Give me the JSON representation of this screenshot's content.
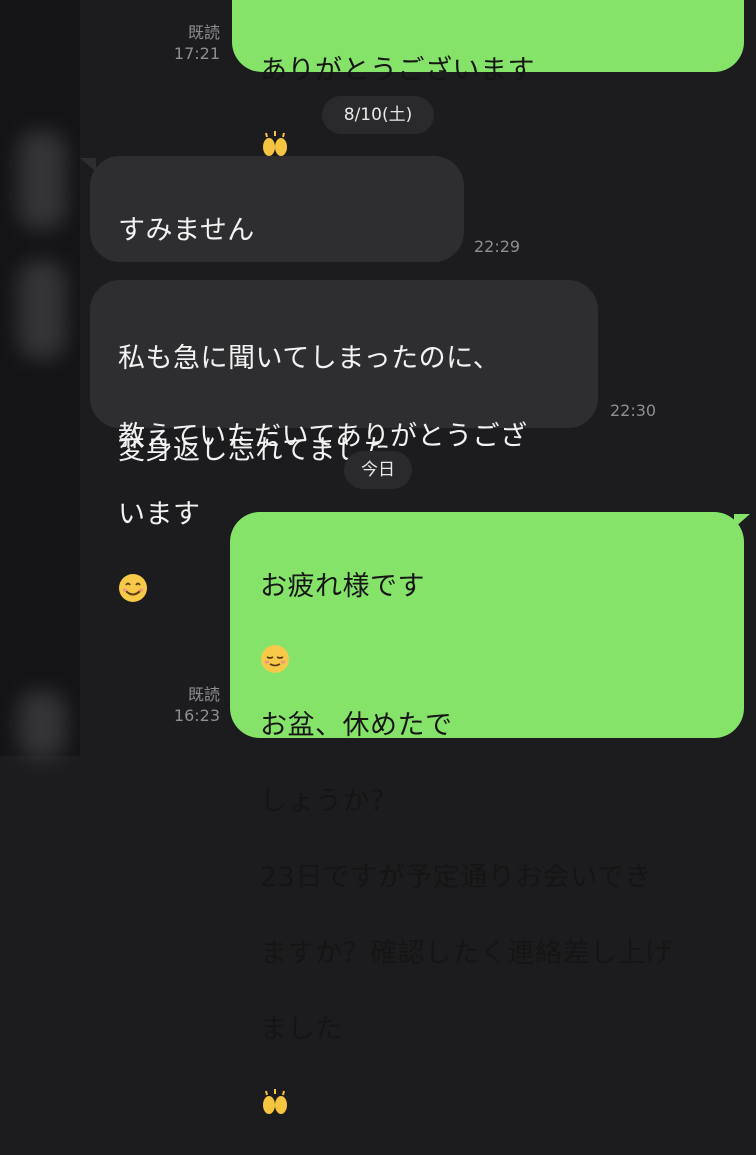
{
  "colors": {
    "background": "#1c1c1e",
    "outgoing_bubble": "#86e36a",
    "incoming_bubble": "#2e2e31",
    "meta_text": "#8e8e93"
  },
  "messages": [
    {
      "direction": "out",
      "text": "ありがとうございます",
      "emoji": "raising-hands-icon",
      "read_label": "既読",
      "time": "17:21"
    },
    {
      "direction": "in",
      "line1": "すみません",
      "line1_emoji": "person-bowing-icon",
      "line2": "変身返し忘れてました、",
      "time": "22:29"
    },
    {
      "direction": "in",
      "line1": "私も急に聞いてしまったのに、",
      "line2": "教えていただいてありがとうござ",
      "line3": "います",
      "line3_emoji": "smiling-face-icon",
      "time": "22:30"
    },
    {
      "direction": "out",
      "line1a": "お疲れ様です",
      "line1_emoji": "relieved-smile-icon",
      "line1b": "お盆、休めたで",
      "line2": "しょうか？",
      "line3": "23日ですが予定通りお会いでき",
      "line4": "ますか？確認したく連絡差し上げ",
      "line5": "ました",
      "line5_emoji": "raising-hands-icon",
      "read_label": "既読",
      "time": "16:23"
    }
  ],
  "date_separators": {
    "first": "8/10(土)",
    "second": "今日"
  }
}
